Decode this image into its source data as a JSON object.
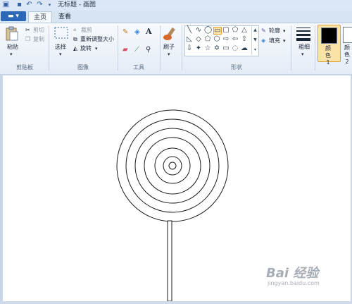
{
  "window": {
    "title": "无标题 - 画图"
  },
  "menu": {
    "file_label": "",
    "tabs": [
      "主页",
      "查看"
    ]
  },
  "clipboard": {
    "paste": "粘贴",
    "cut": "剪切",
    "copy": "复制",
    "group": "剪贴板"
  },
  "image": {
    "select": "选择",
    "crop": "裁剪",
    "resize": "重新调整大小",
    "rotate": "旋转",
    "group": "图像"
  },
  "tools": {
    "group": "工具",
    "text_glyph": "A"
  },
  "brushes": {
    "label": "刷子"
  },
  "shapes": {
    "outline": "轮廓",
    "fill": "填充",
    "group": "形状"
  },
  "size": {
    "label": "粗细"
  },
  "colors": {
    "color1": "颜色 1",
    "color2": "颜色 2",
    "color1_value": "#000000",
    "color2_value": "#ffffff"
  },
  "watermark": {
    "text": "Bai 经验",
    "sub": "jingyan.baidu.com"
  }
}
